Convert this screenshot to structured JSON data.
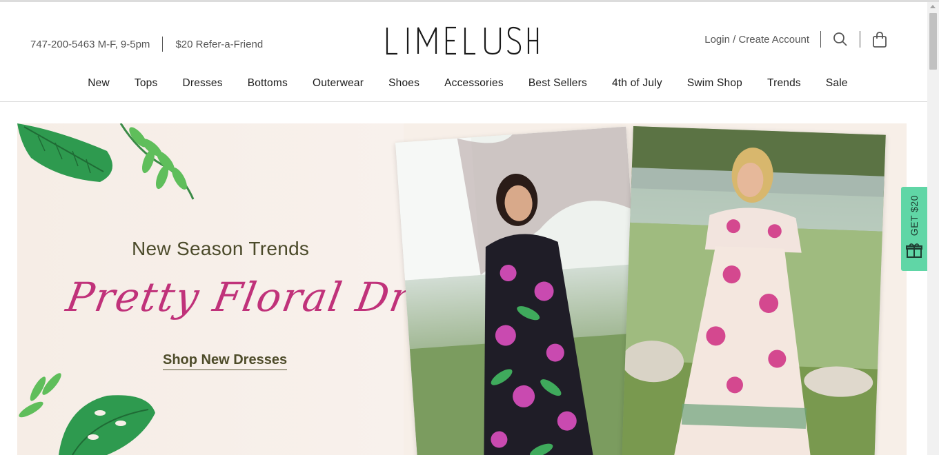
{
  "header": {
    "phone": "747-200-5463 M-F, 9-5pm",
    "refer": "$20 Refer-a-Friend",
    "logo_text": "LIMELUSH",
    "account": "Login / Create Account"
  },
  "nav": {
    "items": [
      "New",
      "Tops",
      "Dresses",
      "Bottoms",
      "Outerwear",
      "Shoes",
      "Accessories",
      "Best Sellers",
      "4th of July",
      "Swim Shop",
      "Trends",
      "Sale"
    ]
  },
  "hero": {
    "title": "New Season Trends",
    "script_title": "Pretty Floral Dresses",
    "cta": "Shop New Dresses"
  },
  "gift_tab": {
    "label": "GET $20"
  },
  "colors": {
    "accent_green": "#60d6a6",
    "script_pink": "#c0327a",
    "olive_text": "#4b4a2a"
  },
  "icons": [
    "search-icon",
    "bag-icon",
    "gift-icon",
    "leaf-icon"
  ]
}
